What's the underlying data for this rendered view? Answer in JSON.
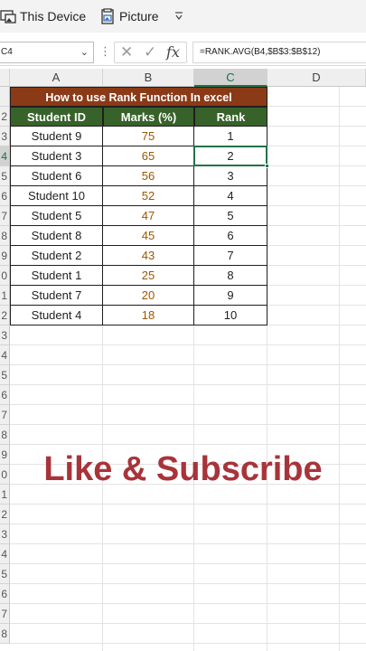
{
  "ribbon": {
    "insert_device_label": "This Device",
    "picture_label": "Picture",
    "more_icon": "chevron-down-icon"
  },
  "formula_bar": {
    "name_box": "C4",
    "formula": "=RANK.AVG(B4,$B$3:$B$12)",
    "fx_label": "fx"
  },
  "columns": [
    "A",
    "B",
    "C",
    "D"
  ],
  "selected_column": "C",
  "row_labels": [
    "",
    "2",
    "3",
    "4",
    "5",
    "6",
    "7",
    "8",
    "9",
    "0",
    "1",
    "2",
    "3",
    "4",
    "5",
    "6",
    "7",
    "8",
    "9",
    "0",
    "1",
    "2",
    "3",
    "4",
    "5",
    "6",
    "7",
    "8"
  ],
  "selected_row_index": 3,
  "table": {
    "title": "How to use Rank Function In excel",
    "headers": [
      "Student ID",
      "Marks (%)",
      "Rank"
    ],
    "rows": [
      [
        "Student 9",
        "75",
        "1"
      ],
      [
        "Student 3",
        "65",
        "2"
      ],
      [
        "Student 6",
        "56",
        "3"
      ],
      [
        "Student 10",
        "52",
        "4"
      ],
      [
        "Student 5",
        "47",
        "5"
      ],
      [
        "Student 8",
        "45",
        "6"
      ],
      [
        "Student 2",
        "43",
        "7"
      ],
      [
        "Student 1",
        "25",
        "8"
      ],
      [
        "Student 7",
        "20",
        "9"
      ],
      [
        "Student 4",
        "18",
        "10"
      ]
    ],
    "title_color": "#8b3a17",
    "header_color": "#37622a"
  },
  "overlay_text": "Like & Subscribe",
  "overlay_color": "#a8343a"
}
